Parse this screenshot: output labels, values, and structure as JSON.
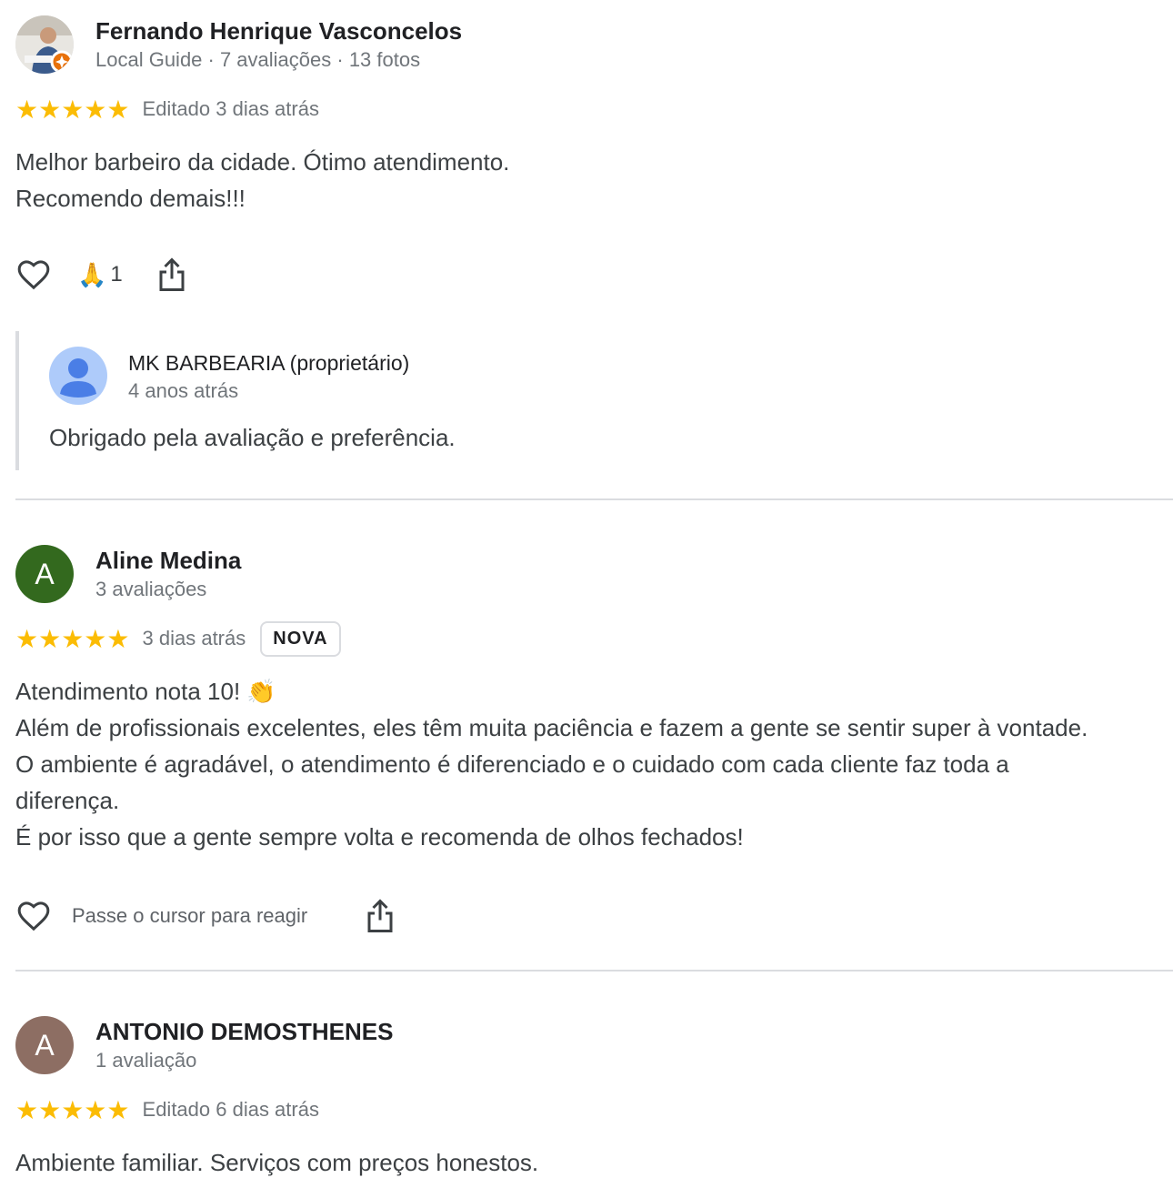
{
  "reviews": [
    {
      "author": "Fernando Henrique Vasconcelos",
      "meta": "Local Guide · 7 avaliações · 13 fotos",
      "stars": "★★★★★",
      "date": "Editado 3 dias atrás",
      "text": [
        "Melhor barbeiro da cidade. Ótimo atendimento.",
        "Recomendo demais!!!"
      ],
      "reaction_emoji": "🙏",
      "reaction_count": "1"
    },
    {
      "avatar_letter": "A",
      "avatar_color": "#33691e",
      "author": "Aline Medina",
      "meta": "3 avaliações",
      "stars": "★★★★★",
      "date": "3 dias atrás",
      "badge": "NOVA",
      "text": [
        "Atendimento nota 10! 👏",
        "Além de profissionais excelentes, eles têm muita paciência e fazem a gente se sentir super à vontade.",
        "O ambiente é agradável, o atendimento é diferenciado e o cuidado com cada cliente faz toda a",
        "diferença.",
        "É por isso que a gente sempre volta e recomenda de olhos fechados!"
      ],
      "hover_hint": "Passe o cursor para reagir"
    },
    {
      "avatar_letter": "A",
      "avatar_color": "#8d6e63",
      "author": "ANTONIO DEMOSTHENES",
      "meta": "1 avaliação",
      "stars": "★★★★★",
      "date": "Editado 6 dias atrás",
      "text": [
        "Ambiente familiar. Serviços com preços honestos."
      ]
    }
  ],
  "owner_reply": {
    "name": "MK BARBEARIA (proprietário)",
    "date": "4 anos atrás",
    "text": "Obrigado pela avaliação e preferência."
  },
  "colors": {
    "star": "#fbbc04",
    "divider": "#dadce0",
    "owner_avatar_bg": "#aecbfa",
    "owner_avatar_fg": "#4285f4"
  }
}
